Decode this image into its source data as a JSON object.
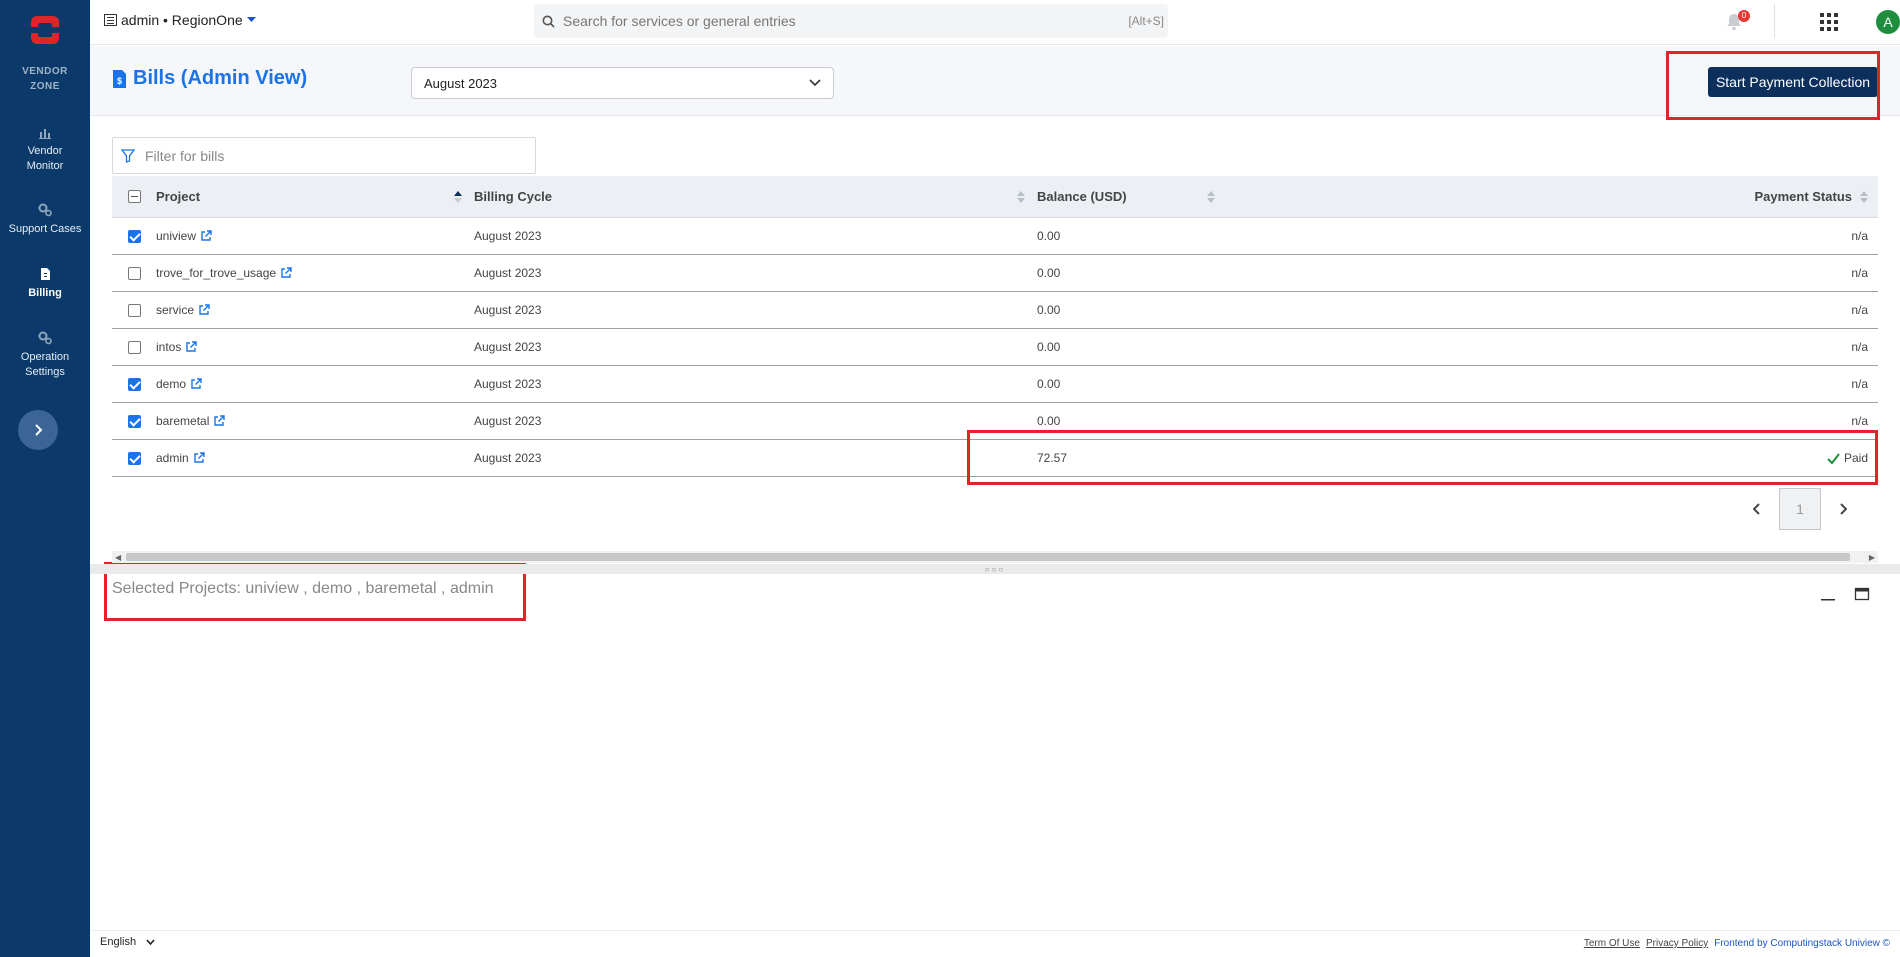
{
  "sidebar": {
    "logo_text_1": "VENDOR",
    "logo_text_2": "ZONE",
    "items": [
      {
        "label_1": "Vendor",
        "label_2": "Monitor"
      },
      {
        "label_1": "Support Cases"
      },
      {
        "label_1": "Billing"
      },
      {
        "label_1": "Operation",
        "label_2": "Settings"
      }
    ]
  },
  "topbar": {
    "context": "admin • RegionOne",
    "search_placeholder": "Search for services or general entries",
    "search_shortcut": "[Alt+S]",
    "notification_count": "0",
    "avatar_letter": "A"
  },
  "header": {
    "title": "Bills (Admin View)",
    "billing_cycle": "August 2023",
    "primary_action": "Start Payment Collection"
  },
  "filter": {
    "placeholder": "Filter for bills"
  },
  "table": {
    "columns": [
      "Project",
      "Billing Cycle",
      "Balance (USD)",
      "Payment Status"
    ],
    "rows": [
      {
        "project": "uniview",
        "cycle": "August 2023",
        "balance": "0.00",
        "status": "n/a",
        "checked": true
      },
      {
        "project": "trove_for_trove_usage",
        "cycle": "August 2023",
        "balance": "0.00",
        "status": "n/a",
        "checked": false
      },
      {
        "project": "service",
        "cycle": "August 2023",
        "balance": "0.00",
        "status": "n/a",
        "checked": false
      },
      {
        "project": "intos",
        "cycle": "August 2023",
        "balance": "0.00",
        "status": "n/a",
        "checked": false
      },
      {
        "project": "demo",
        "cycle": "August 2023",
        "balance": "0.00",
        "status": "n/a",
        "checked": true
      },
      {
        "project": "baremetal",
        "cycle": "August 2023",
        "balance": "0.00",
        "status": "n/a",
        "checked": true
      },
      {
        "project": "admin",
        "cycle": "August 2023",
        "balance": "72.57",
        "status": "Paid",
        "checked": true
      }
    ]
  },
  "pagination": {
    "current": "1"
  },
  "selected_projects": "Selected Projects: uniview , demo , baremetal , admin",
  "footer": {
    "language": "English",
    "links": [
      "Term Of Use",
      "Privacy Policy"
    ],
    "credit": "Frontend by Computingstack Uniview ©"
  },
  "colors": {
    "sidebar": "#0b3a6a",
    "primary": "#0d2f5c",
    "accent": "#1a73e8",
    "highlight": "#e0242a",
    "paid": "#1e8e3e"
  }
}
